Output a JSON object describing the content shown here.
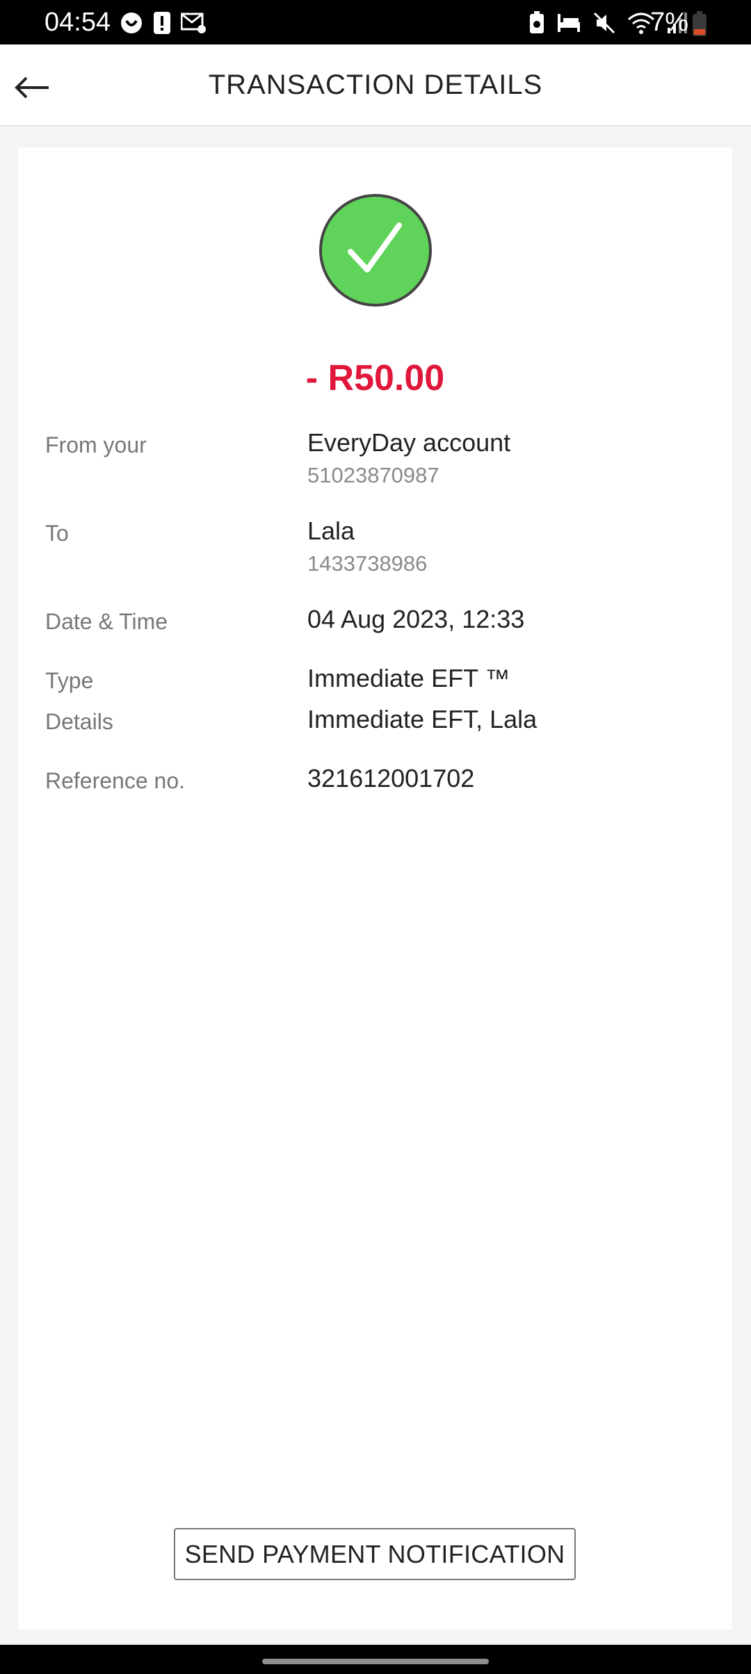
{
  "status_bar": {
    "time": "04:54",
    "battery": "7%",
    "left_icons": [
      "heart-chat-icon",
      "alert-icon",
      "mail-settings-icon"
    ],
    "right_icons": [
      "battery-saver-icon",
      "bed-icon",
      "mute-icon",
      "wifi-icon",
      "signal-icon"
    ]
  },
  "header": {
    "title": "TRANSACTION DETAILS",
    "back_icon": "arrow-left-icon"
  },
  "transaction": {
    "status_icon": "success-check-icon",
    "amount": "- R50.00",
    "from_label": "From your",
    "from_account_name": "EveryDay account",
    "from_account_number": "51023870987",
    "to_label": "To",
    "to_name": "Lala",
    "to_number": "1433738986",
    "datetime_label": "Date & Time",
    "datetime_value": "04 Aug 2023, 12:33",
    "type_label": "Type",
    "type_value": "Immediate EFT ™",
    "details_label": "Details",
    "details_value": "Immediate EFT, Lala",
    "reference_label": "Reference no.",
    "reference_value": "321612001702"
  },
  "actions": {
    "send_notification": "SEND PAYMENT NOTIFICATION"
  },
  "colors": {
    "amount": "#e0173b",
    "success": "#5fd35a"
  }
}
